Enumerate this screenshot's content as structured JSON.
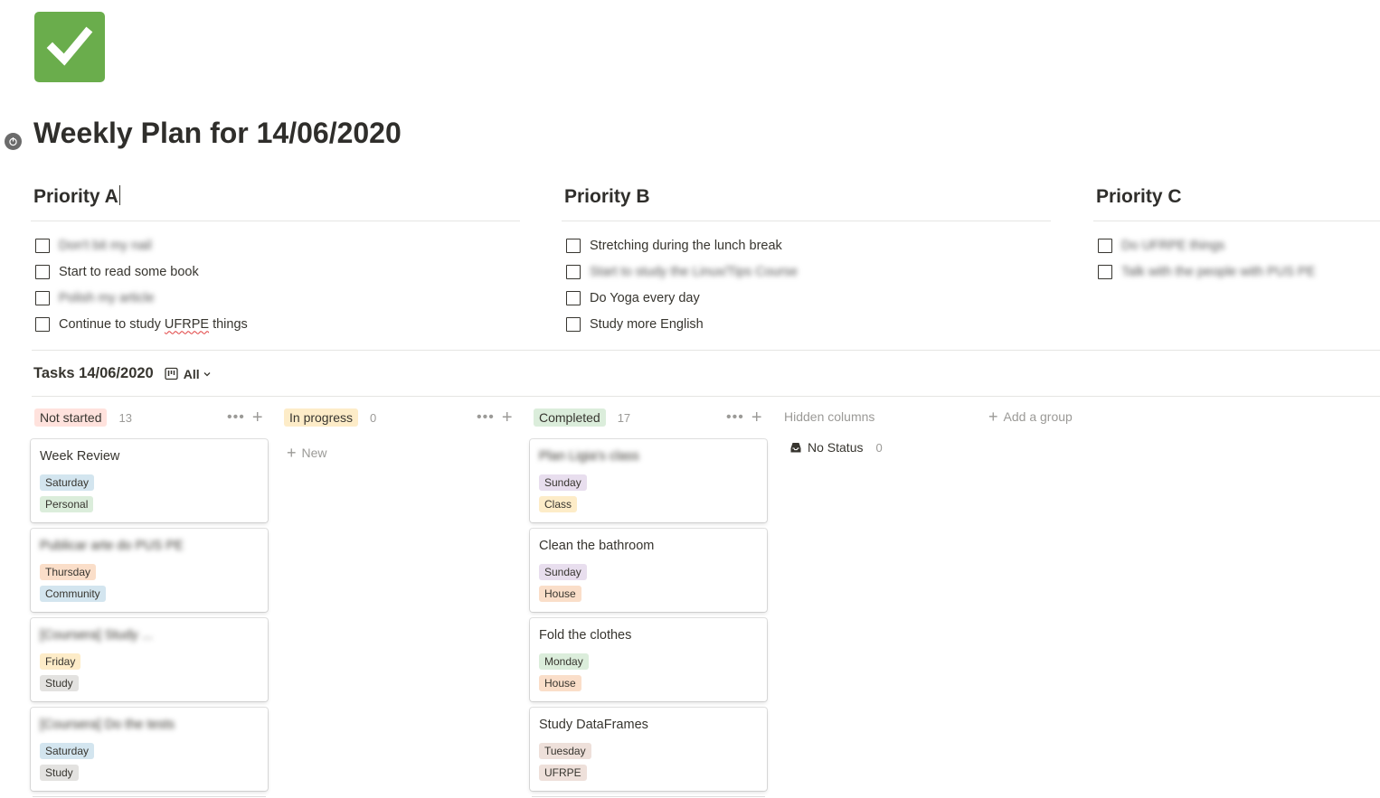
{
  "page": {
    "title": "Weekly Plan for 14/06/2020",
    "icon": "check-mark-icon"
  },
  "priorities": [
    {
      "title": "Priority A",
      "items": [
        {
          "text": "Don't bit my nail",
          "blurred": true
        },
        {
          "text": "Start to read some book",
          "blurred": false
        },
        {
          "text": "Polish my article",
          "blurred": true
        },
        {
          "text": "Continue to study UFRPE things",
          "blurred": false
        }
      ]
    },
    {
      "title": "Priority B",
      "items": [
        {
          "text": "Stretching during the lunch break",
          "blurred": false
        },
        {
          "text": "Start to study the Linux/Tips Course",
          "blurred": true
        },
        {
          "text": "Do Yoga every day",
          "blurred": false
        },
        {
          "text": "Study more English",
          "blurred": false
        }
      ]
    },
    {
      "title": "Priority C",
      "items": [
        {
          "text": "Do UFRPE things",
          "blurred": true
        },
        {
          "text": "Talk with the people with PUS PE",
          "blurred": true
        }
      ]
    }
  ],
  "tasks": {
    "title": "Tasks 14/06/2020",
    "view_label": "All",
    "columns": [
      {
        "label": "Not started",
        "count": "13",
        "color": "#ffe2dd"
      },
      {
        "label": "In progress",
        "count": "0",
        "color": "#fdecc8"
      },
      {
        "label": "Completed",
        "count": "17",
        "color": "#dbeddb"
      }
    ],
    "hidden_columns_label": "Hidden columns",
    "add_group_label": "Add a group",
    "new_label": "New",
    "no_status": {
      "label": "No Status",
      "count": "0"
    },
    "cards_not_started": [
      {
        "title": "Week Review",
        "blurred": false,
        "day": "Saturday",
        "day_color": "blue",
        "tag": "Personal",
        "tag_color": "green"
      },
      {
        "title": "Publicar arte do PUS PE",
        "blurred": true,
        "day": "Thursday",
        "day_color": "orange",
        "tag": "Community",
        "tag_color": "blue"
      },
      {
        "title": "[Coursera] Study ...",
        "blurred": true,
        "day": "Friday",
        "day_color": "yellow",
        "tag": "Study",
        "tag_color": "gray"
      },
      {
        "title": "[Coursera] Do the tests",
        "blurred": true,
        "day": "Saturday",
        "day_color": "blue",
        "tag": "Study",
        "tag_color": "gray"
      }
    ],
    "cards_completed": [
      {
        "title": "Plan Ligia's class",
        "blurred": true,
        "day": "Sunday",
        "day_color": "purple",
        "tag": "Class",
        "tag_color": "yellow"
      },
      {
        "title": "Clean the bathroom",
        "blurred": false,
        "day": "Sunday",
        "day_color": "purple",
        "tag": "House",
        "tag_color": "orange"
      },
      {
        "title": "Fold the clothes",
        "blurred": false,
        "day": "Monday",
        "day_color": "green",
        "tag": "House",
        "tag_color": "orange"
      },
      {
        "title": "Study DataFrames",
        "blurred": false,
        "day": "Tuesday",
        "day_color": "brown",
        "tag": "UFRPE",
        "tag_color": "brown"
      }
    ]
  }
}
